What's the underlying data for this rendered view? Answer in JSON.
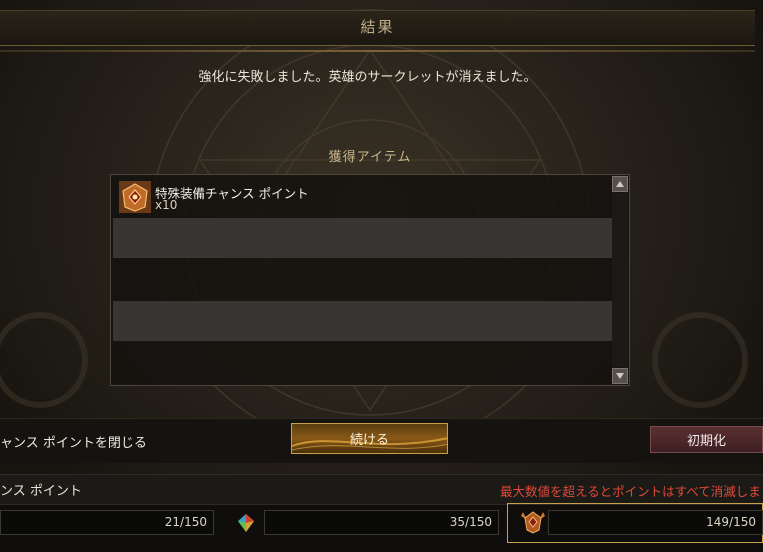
{
  "title": "結果",
  "message": "強化に失敗しました。英雄のサークレットが消えました。",
  "acquired_header": "獲得アイテム",
  "items": [
    {
      "name": "特殊装備チャンス ポイント",
      "quantity": "x10",
      "icon": "equipment-chance-badge-icon"
    }
  ],
  "buttons": {
    "close_label": "ャンス ポイントを閉じる",
    "continue_label": "続ける",
    "reset_label": "初期化"
  },
  "points": {
    "label": "ンス ポイント",
    "warning": "最大数値を超えるとポイントはすべて消滅しま",
    "slots": [
      {
        "value": "21/150",
        "icon": ""
      },
      {
        "value": "35/150",
        "icon": "gem-icon"
      },
      {
        "value": "149/150",
        "icon": "badge-icon"
      }
    ]
  },
  "colors": {
    "accent": "#c8a14a",
    "warning": "#e0483a",
    "title": "#bfae88"
  }
}
